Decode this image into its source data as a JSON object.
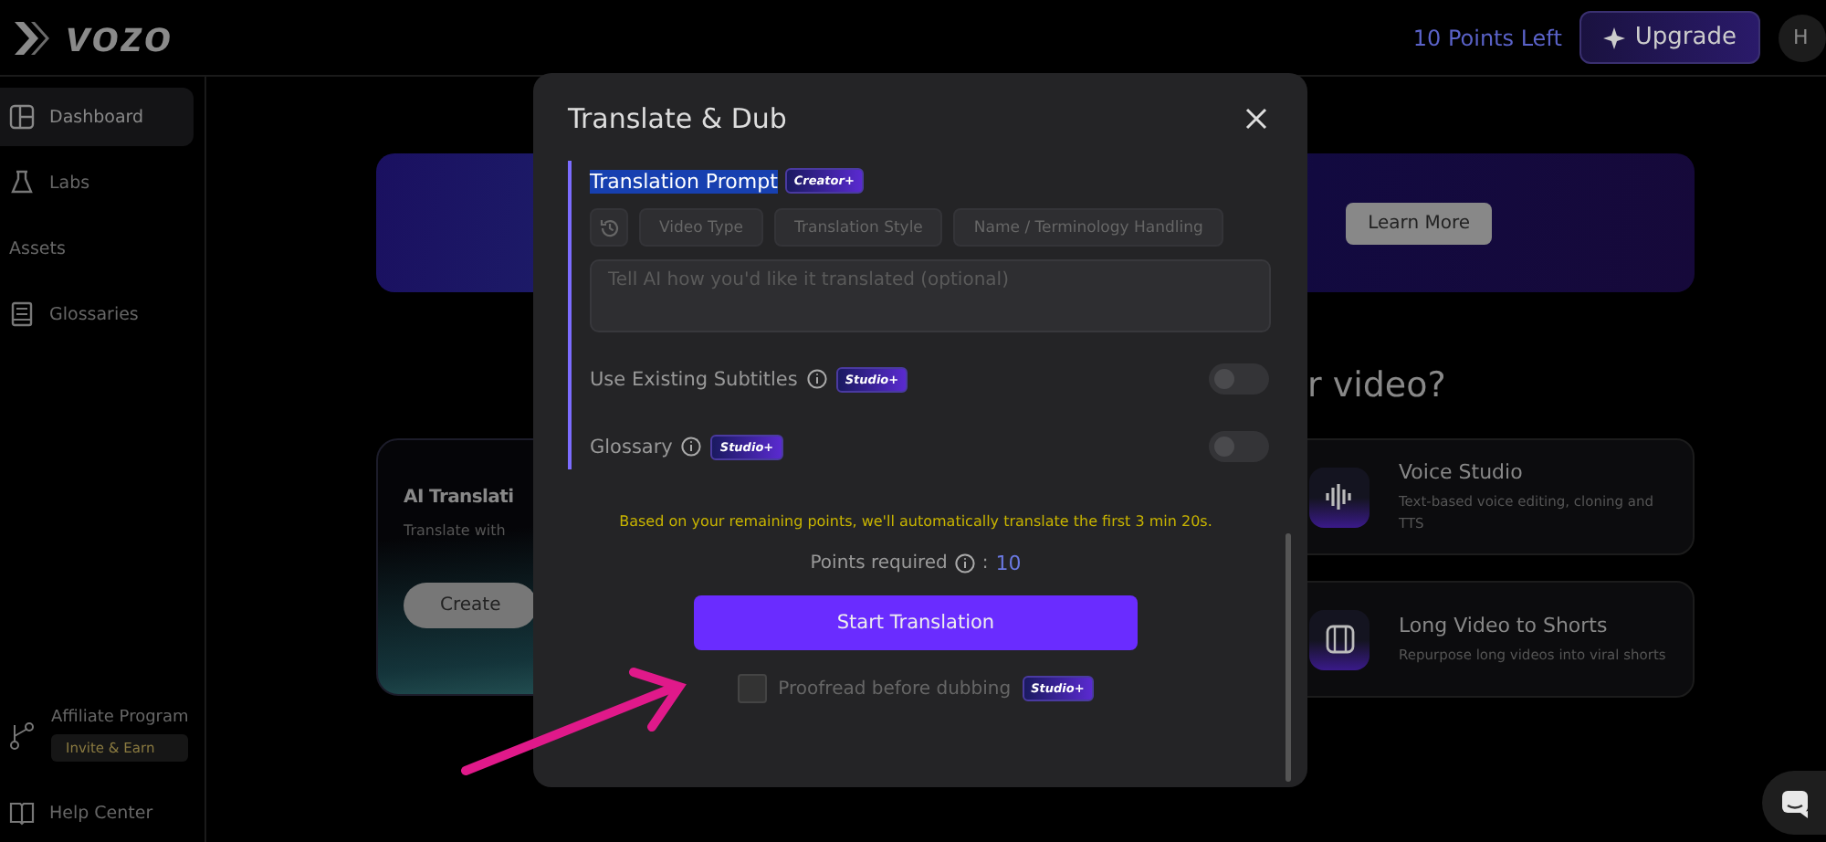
{
  "app": {
    "logo": "vozo",
    "points_left": "10 Points Left",
    "upgrade": "Upgrade",
    "avatar": "H"
  },
  "sidebar": {
    "items": [
      {
        "label": "Dashboard",
        "kind": "layout",
        "selected": true
      },
      {
        "label": "Labs",
        "kind": "flask",
        "selected": false
      },
      {
        "label": "Assets",
        "kind": "plain",
        "selected": false
      },
      {
        "label": "Glossaries",
        "kind": "book",
        "selected": false
      }
    ],
    "affiliate": {
      "label": "Affiliate Program",
      "action": "Invite & Earn"
    },
    "help": "Help Center"
  },
  "dashboard": {
    "banner": {
      "button": "Learn More"
    },
    "heading": "r video?",
    "main_card": {
      "title": "AI Translati",
      "subtitle": "Translate with",
      "button": "Create"
    },
    "tools": [
      {
        "title": "Voice Studio",
        "description": "Text-based voice editing, cloning and TTS",
        "kind": "wave"
      },
      {
        "title": "Long Video to Shorts",
        "description": "Repurpose long videos into viral shorts",
        "kind": "film"
      }
    ]
  },
  "dialog": {
    "title": "Translate & Dub",
    "prompt": {
      "label": "Translation Prompt",
      "selected": true,
      "badge": "Creator+",
      "chips": [
        "Video Type",
        "Translation Style",
        "Name / Terminology Handling"
      ],
      "placeholder": "Tell AI how you'd like it translated (optional)"
    },
    "options": [
      {
        "label": "Use Existing Subtitles",
        "badge": "Studio+",
        "on": false
      },
      {
        "label": "Glossary",
        "badge": "Studio+",
        "on": false
      }
    ],
    "notice": "Based on your remaining points, we'll automatically translate the first 3 min 20s.",
    "points_label": "Points required",
    "points_separator": ":",
    "points_value": "10",
    "start_button": "Start Translation",
    "proofread": {
      "label": "Proofread before dubbing",
      "badge": "Studio+",
      "checked": false
    }
  }
}
